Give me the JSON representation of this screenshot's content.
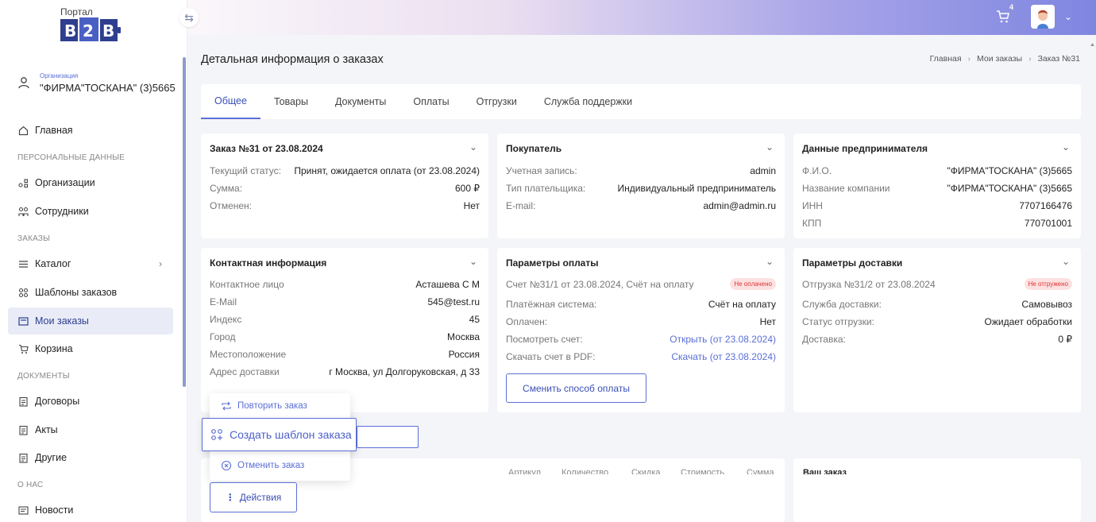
{
  "sidebar": {
    "logo_top": "Портал",
    "logo_text": "B2B",
    "org_label": "Организация",
    "org_name": "\"ФИРМА\"ТОСКАНА\" (3)5665",
    "items": [
      {
        "label": "Главная",
        "icon": "home-icon"
      },
      {
        "label": "Организации",
        "icon": "org-icon"
      },
      {
        "label": "Сотрудники",
        "icon": "users-icon"
      },
      {
        "label": "Каталог",
        "icon": "list-icon"
      },
      {
        "label": "Шаблоны заказов",
        "icon": "template-icon"
      },
      {
        "label": "Мои заказы",
        "icon": "orders-icon"
      },
      {
        "label": "Корзина",
        "icon": "cart-icon"
      },
      {
        "label": "Договоры",
        "icon": "document-icon"
      },
      {
        "label": "Акты",
        "icon": "document-icon"
      },
      {
        "label": "Другие",
        "icon": "document-icon"
      },
      {
        "label": "Новости",
        "icon": "news-icon"
      }
    ],
    "sections": [
      "ПЕРСОНАЛЬНЫЕ ДАННЫЕ",
      "ЗАКАЗЫ",
      "ДОКУМЕНТЫ",
      "О НАС"
    ]
  },
  "header": {
    "cart_count": "4"
  },
  "page": {
    "title": "Детальная информация о заказах",
    "breadcrumb": [
      "Главная",
      "Мои заказы",
      "Заказ №31"
    ]
  },
  "tabs": [
    "Общее",
    "Товары",
    "Документы",
    "Оплаты",
    "Отгрузки",
    "Служба поддержки"
  ],
  "order": {
    "title": "Заказ №31 от 23.08.2024",
    "rows": [
      {
        "k": "Текущий статус:",
        "v": "Принят, ожидается оплата (от 23.08.2024)"
      },
      {
        "k": "Сумма:",
        "v": "600 ₽"
      },
      {
        "k": "Отменен:",
        "v": "Нет"
      }
    ]
  },
  "buyer": {
    "title": "Покупатель",
    "rows": [
      {
        "k": "Учетная запись:",
        "v": "admin"
      },
      {
        "k": "Тип плательщика:",
        "v": "Индивидуальный предприниматель"
      },
      {
        "k": "E-mail:",
        "v": "admin@admin.ru"
      }
    ]
  },
  "entrepreneur": {
    "title": "Данные предпринимателя",
    "rows": [
      {
        "k": "Ф.И.О.",
        "v": "\"ФИРМА\"ТОСКАНА\" (3)5665"
      },
      {
        "k": "Название компании",
        "v": "\"ФИРМА\"ТОСКАНА\" (3)5665"
      },
      {
        "k": "ИНН",
        "v": "7707166476"
      },
      {
        "k": "КПП",
        "v": "770701001"
      }
    ]
  },
  "contact": {
    "title": "Контактная информация",
    "rows": [
      {
        "k": "Контактное лицо",
        "v": "Асташева С М"
      },
      {
        "k": "E-Mail",
        "v": "545@test.ru"
      },
      {
        "k": "Индекс",
        "v": "45"
      },
      {
        "k": "Город",
        "v": "Москва"
      },
      {
        "k": "Местоположение",
        "v": "Россия"
      },
      {
        "k": "Адрес доставки",
        "v": "г Москва, ул Долгоруковская, д 33"
      }
    ]
  },
  "payment": {
    "title": "Параметры оплаты",
    "invoice": "Счет №31/1 от 23.08.2024, Счёт на оплату",
    "invoice_status": "Не оплачено",
    "rows": [
      {
        "k": "Платёжная система:",
        "v": "Счёт на оплату"
      },
      {
        "k": "Оплачен:",
        "v": "Нет"
      },
      {
        "k": "Посмотреть счет:",
        "v": "Открыть (от 23.08.2024)"
      },
      {
        "k": "Скачать счет в PDF:",
        "v": "Скачать (от 23.08.2024)"
      }
    ],
    "change_btn": "Сменить способ оплаты"
  },
  "delivery": {
    "title": "Параметры доставки",
    "shipment": "Отгрузка №31/2 от 23.08.2024",
    "shipment_status": "Не отгружено",
    "rows": [
      {
        "k": "Служба доставки:",
        "v": "Самовывоз"
      },
      {
        "k": "Статус отгрузки:",
        "v": "Ожидает обработки"
      },
      {
        "k": "Доставка:",
        "v": "0 ₽"
      }
    ]
  },
  "menu": {
    "repeat": "Повторить заказ",
    "create_template": "Создать шаблон заказа",
    "cancel": "Отменить заказ",
    "actions": "Действия"
  },
  "table_headers": [
    "Артикул",
    "Количество",
    "Скидка",
    "Стоимость",
    "Сумма"
  ],
  "your_order": "Ваш заказ"
}
